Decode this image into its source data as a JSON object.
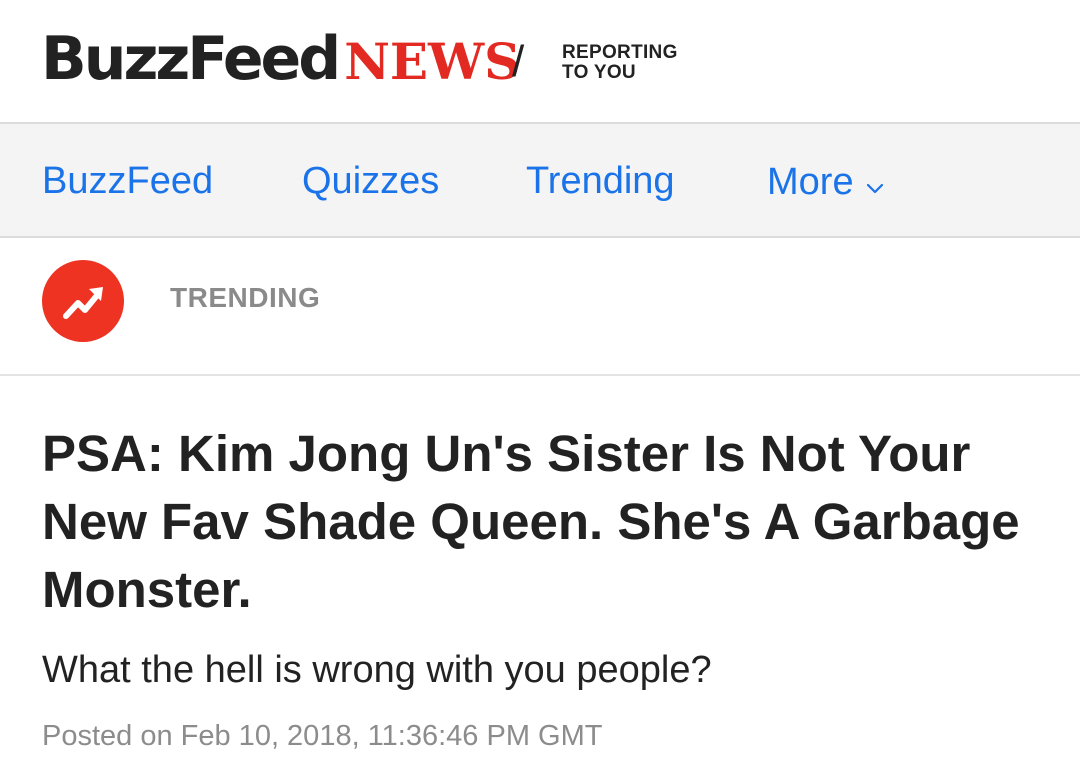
{
  "header": {
    "logo_primary": "BuzzFeed",
    "logo_secondary": "NEWS",
    "separator": "/",
    "tagline_line1": "REPORTING",
    "tagline_line2": "TO YOU",
    "colors": {
      "news_red": "#e32a22",
      "text_dark": "#222222"
    }
  },
  "nav": {
    "items": [
      {
        "label": "BuzzFeed"
      },
      {
        "label": "Quizzes"
      },
      {
        "label": "Trending"
      },
      {
        "label": "More",
        "icon": "chevron-down-icon"
      }
    ],
    "link_color": "#1a73e8"
  },
  "trending": {
    "badge_icon": "trending-arrow-icon",
    "badge_color": "#ee3322",
    "label": "TRENDING"
  },
  "article": {
    "headline": "PSA: Kim Jong Un's Sister Is Not Your New Fav Shade Queen. She's A Garbage Monster.",
    "dek": "What the hell is wrong with you people?",
    "posted": "Posted on Feb 10, 2018, 11:36:46 PM GMT"
  }
}
